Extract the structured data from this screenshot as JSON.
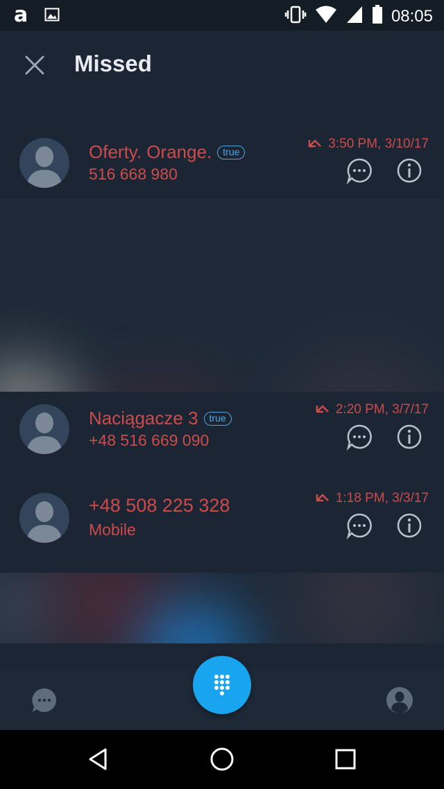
{
  "status_bar": {
    "time": "08:05",
    "left_icons": [
      "app-a-icon",
      "image-icon"
    ],
    "right_icons": [
      "vibrate-icon",
      "wifi-icon",
      "signal-icon",
      "battery-icon"
    ]
  },
  "header": {
    "title": "Missed",
    "close_icon": "close-icon"
  },
  "colors": {
    "background": "#1b2533",
    "missed_red": "#cc4b4b",
    "badge_blue": "#4ea8e8",
    "fab_blue": "#18a4ef"
  },
  "calls": [
    {
      "name": "Oferty. Orange.",
      "badge": "true",
      "detail": "516 668 980",
      "time": "3:50 PM, 3/10/17"
    },
    {
      "name": "Naciągacze 3",
      "badge": "true",
      "detail": "+48 516 669 090",
      "time": "2:20 PM, 3/7/17"
    },
    {
      "name": "+48 508 225 328",
      "badge": "",
      "detail": "Mobile",
      "time": "1:18 PM, 3/3/17"
    }
  ],
  "bottom_bar": {
    "left_icon": "message-icon",
    "fab_icon": "dialpad-icon",
    "right_icon": "profile-icon"
  },
  "nav_bar": {
    "icons": [
      "back-icon",
      "home-icon",
      "recents-icon"
    ]
  }
}
